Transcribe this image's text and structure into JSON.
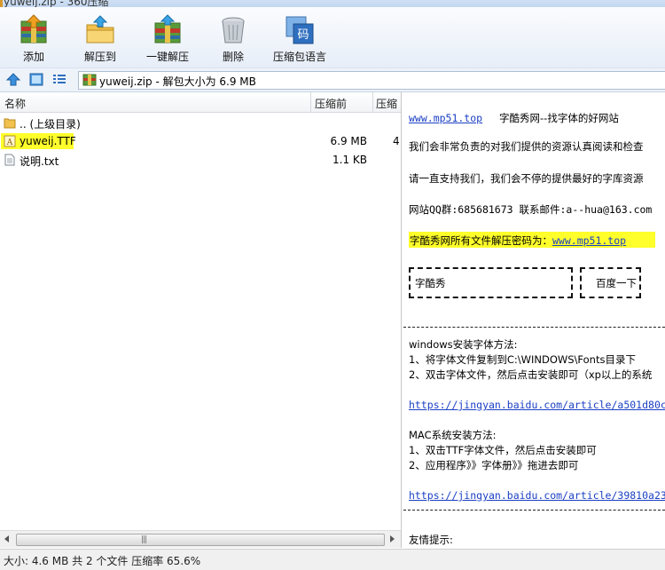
{
  "window": {
    "title": "yuweij.zip - 360压缩"
  },
  "toolbar": {
    "add": "添加",
    "extract_to": "解压到",
    "one_click_extract": "一键解压",
    "delete": "删除",
    "archive_language": "压缩包语言",
    "language_icon_text": "码"
  },
  "address": {
    "path_text": "yuweij.zip - 解包大小为 6.9 MB"
  },
  "file_list": {
    "columns": {
      "name": "名称",
      "compressed_before": "压缩前",
      "compressed_after": "压缩"
    },
    "rows": [
      {
        "name": ".. (上级目录)",
        "size": "",
        "size2": ""
      },
      {
        "name": "yuweij.TTF",
        "size": "6.9 MB",
        "size2": "4"
      },
      {
        "name": "说明.txt",
        "size": "1.1 KB",
        "size2": ""
      }
    ],
    "scroll_grip": "|||"
  },
  "preview": {
    "site_link": "www.mp51.top",
    "site_slogan": "字酷秀网--找字体的好网站",
    "line1": "我们会非常负责的对我们提供的资源认真阅读和检查",
    "line2": "请一直支持我们，我们会不停的提供最好的字库资源",
    "contact": "网站QQ群:685681673  联系邮件:a--hua@163.com",
    "password_label": "字酷秀网所有文件解压密码为：",
    "password_link": "www.mp51.top",
    "box1_text": "字酷秀",
    "box2_text": "百度一下",
    "win_title": "windows安装字体方法:",
    "win_step1": " 1、将字体文件复制到C:\\WINDOWS\\Fonts目录下",
    "win_step2": " 2、双击字体文件，然后点击安装即可（xp以上的系统",
    "win_link": "https://jingyan.baidu.com/article/a501d80c",
    "mac_title": "MAC系统安装方法:",
    "mac_step1": " 1、双击TTF字体文件，然后点击安装即可",
    "mac_step2": " 2、应用程序》》字体册》》拖进去即可",
    "mac_link": "https://jingyan.baidu.com/article/39810a23",
    "friends": "友情提示:"
  },
  "status": {
    "text": "大小: 4.6 MB 共 2 个文件 压缩率 65.6%"
  }
}
